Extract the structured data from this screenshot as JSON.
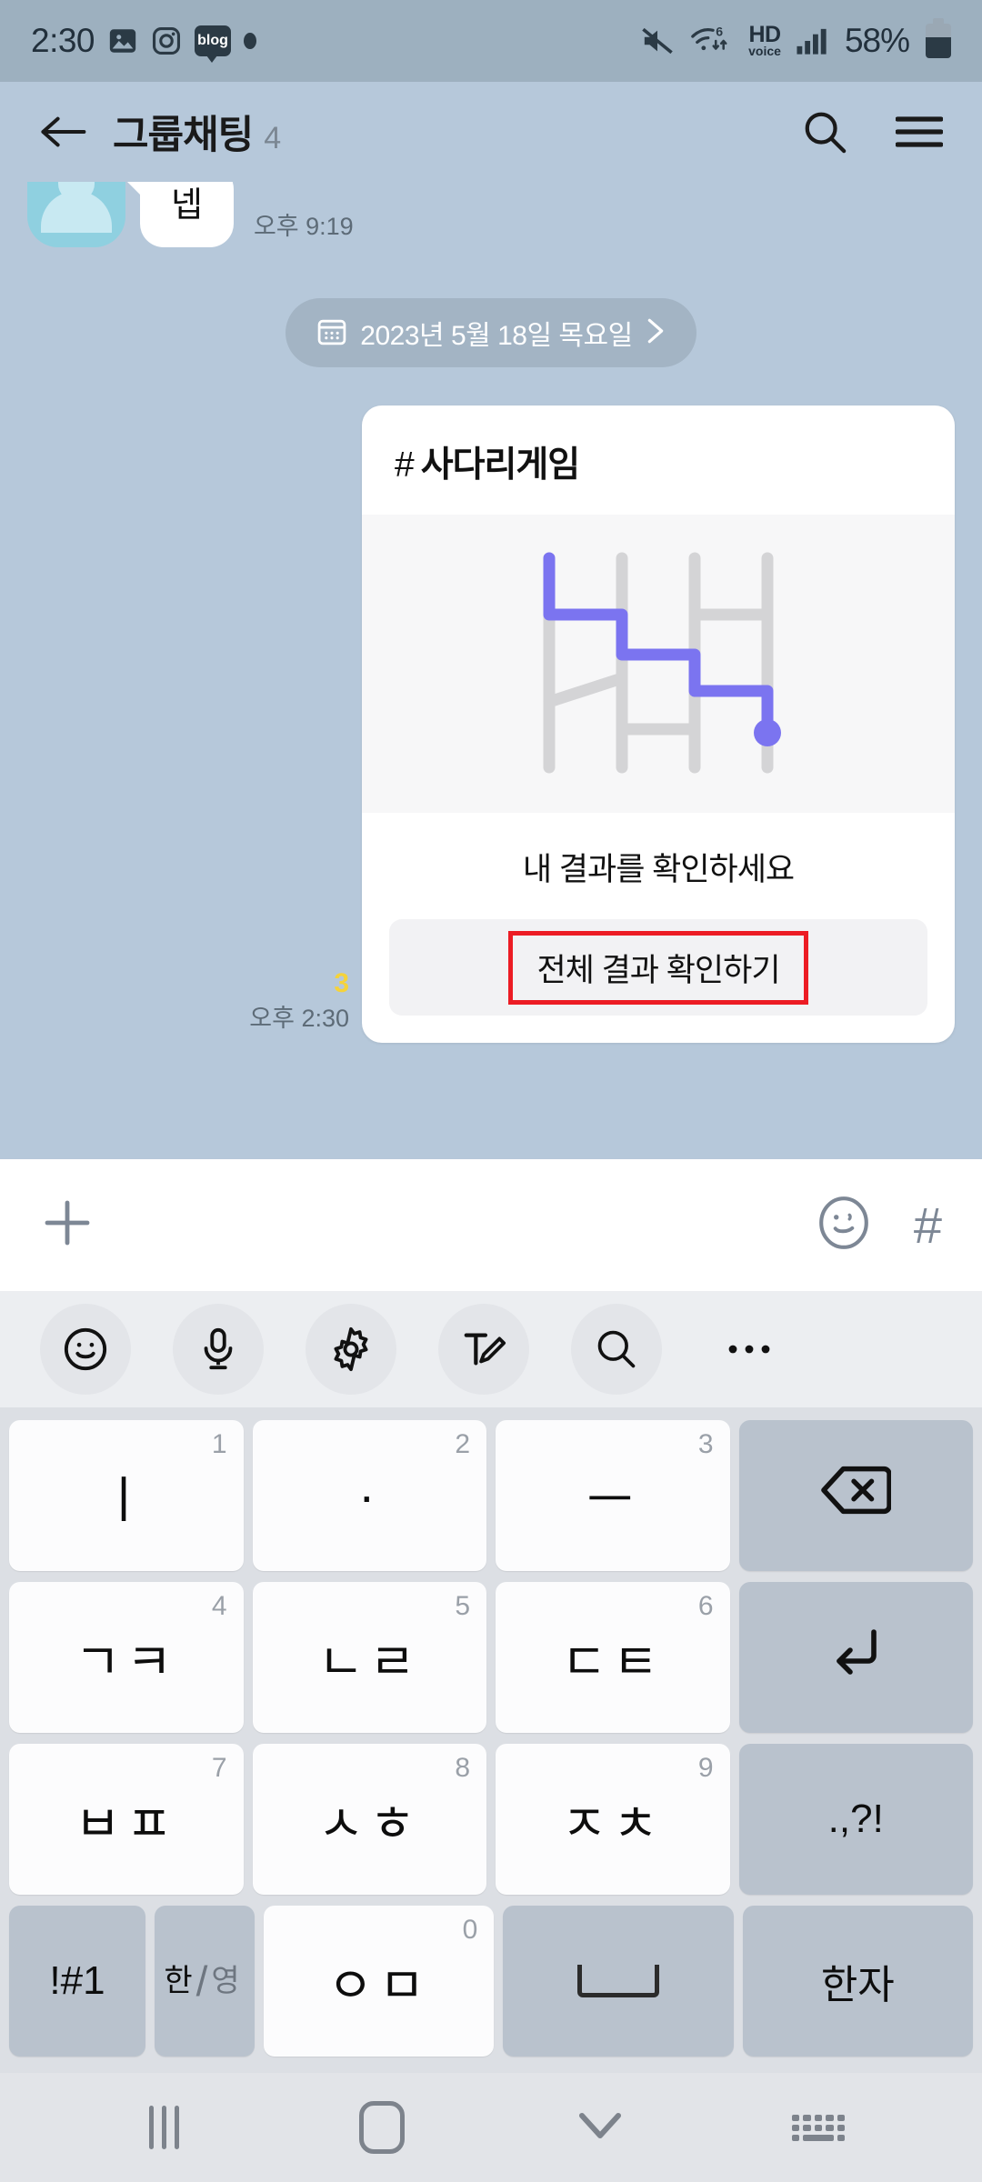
{
  "status_bar": {
    "time": "2:30",
    "battery_percent": "58%",
    "hd_label": "HD",
    "voice_label": "voice",
    "blog_badge": "blog",
    "icons": [
      "photos-icon",
      "instagram-icon",
      "blog-icon",
      "dot-icon",
      "mute-icon",
      "wifi-icon",
      "hd-voice-icon",
      "signal-icon",
      "battery-icon"
    ],
    "wifi_generation": "6"
  },
  "app_bar": {
    "title": "그룹채팅",
    "member_count": "4",
    "back_icon": "arrow-left-icon",
    "search_icon": "search-icon",
    "menu_icon": "hamburger-menu-icon"
  },
  "chat": {
    "background_color": "#b6c8da",
    "messages": [
      {
        "type": "incoming",
        "text": "넵",
        "time": "오후 9:19",
        "avatar": "default-person-avatar"
      }
    ],
    "date_divider": {
      "label": "2023년 5월 18일 목요일",
      "calendar_icon": "calendar-icon",
      "chevron_icon": "chevron-right-icon"
    },
    "game_card": {
      "hash": "#",
      "title": "사다리게임",
      "subtitle": "내 결과를 확인하세요",
      "button_label": "전체 결과 확인하기",
      "highlight_color": "#ec1c24",
      "path_color": "#7b74f0",
      "rail_color": "#d4d4d6",
      "unread_count": "3",
      "time": "오후 2:30"
    }
  },
  "input_bar": {
    "add_icon": "plus-icon",
    "emoji_icon": "emoji-face-icon",
    "hashtag": "#"
  },
  "keyboard": {
    "toolbar": [
      {
        "name": "emoji-icon"
      },
      {
        "name": "microphone-icon"
      },
      {
        "name": "settings-gear-icon"
      },
      {
        "name": "handwriting-icon"
      },
      {
        "name": "search-icon"
      },
      {
        "name": "more-options-icon"
      }
    ],
    "rows": [
      [
        {
          "label": "ㅣ",
          "num": "1",
          "type": "char"
        },
        {
          "label": "·",
          "num": "2",
          "type": "char"
        },
        {
          "label": "ㅡ",
          "num": "3",
          "type": "char"
        },
        {
          "label": "backspace-icon",
          "num": "",
          "type": "fn-icon"
        }
      ],
      [
        {
          "label": "ㄱㅋ",
          "num": "4",
          "type": "char"
        },
        {
          "label": "ㄴㄹ",
          "num": "5",
          "type": "char"
        },
        {
          "label": "ㄷㅌ",
          "num": "6",
          "type": "char"
        },
        {
          "label": "enter-icon",
          "num": "",
          "type": "fn-icon"
        }
      ],
      [
        {
          "label": "ㅂㅍ",
          "num": "7",
          "type": "char"
        },
        {
          "label": "ㅅㅎ",
          "num": "8",
          "type": "char"
        },
        {
          "label": "ㅈㅊ",
          "num": "9",
          "type": "char"
        },
        {
          "label": ".,?!",
          "num": "",
          "type": "fn"
        }
      ]
    ],
    "bottom_row": {
      "symbols_key": "!#1",
      "lang_key_top": "한",
      "lang_key_bottom": "영",
      "char_key": "ㅇㅁ",
      "char_key_num": "0",
      "space_key": "space-icon",
      "hanja_key": "한자"
    }
  },
  "nav_bar": {
    "recents_icon": "recents-icon",
    "home_icon": "home-icon",
    "hide_keyboard_icon": "chevron-down-icon",
    "keyboard_switch_icon": "keyboard-switch-icon"
  }
}
